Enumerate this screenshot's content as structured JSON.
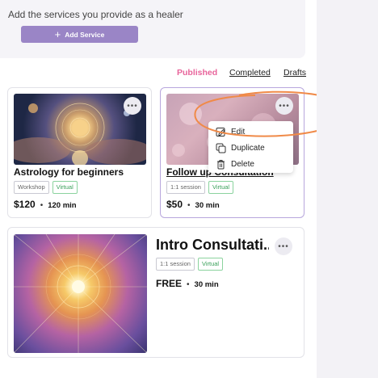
{
  "header": {
    "description": "Add the services you provide as a healer",
    "add_button_label": "Add Service"
  },
  "tabs": {
    "published": "Published",
    "completed": "Completed",
    "drafts": "Drafts",
    "active": "Published"
  },
  "services": [
    {
      "title": "Astrology for beginners",
      "type": "Workshop",
      "mode": "Virtual",
      "price": "$120",
      "separator": "•",
      "duration": "120 min"
    },
    {
      "title": "Follow up Consultation",
      "type": "1:1 session",
      "mode": "Virtual",
      "price": "$50",
      "separator": "•",
      "duration": "30 min"
    },
    {
      "title": "Intro Consultati...",
      "type": "1:1 session",
      "mode": "Virtual",
      "price": "FREE",
      "separator": "•",
      "duration": "30 min"
    }
  ],
  "context_menu": {
    "edit": "Edit",
    "duplicate": "Duplicate",
    "delete": "Delete"
  },
  "colors": {
    "accent": "#9a85c6",
    "tab_active": "#e8649b",
    "virtual_badge": "#3aa05a",
    "highlight_annotation": "#f08a48"
  },
  "icons": {
    "more": "more-horizontal-icon",
    "edit": "edit-icon",
    "duplicate": "duplicate-icon",
    "delete": "trash-icon",
    "add": "plus-icon"
  }
}
